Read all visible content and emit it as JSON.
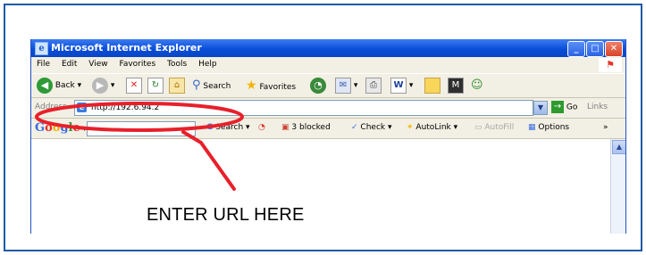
{
  "window": {
    "title": "Microsoft Internet Explorer"
  },
  "menu": [
    "File",
    "Edit",
    "View",
    "Favorites",
    "Tools",
    "Help"
  ],
  "toolbar": {
    "back_label": "Back",
    "search_label": "Search",
    "favorites_label": "Favorites"
  },
  "address": {
    "label": "Address",
    "url": "http://192.6.94.2",
    "go_label": "Go",
    "links_label": "Links"
  },
  "google_toolbar": {
    "logo": "Google",
    "search_label": "Search",
    "blocked_label": "3 blocked",
    "check_label": "Check",
    "autolink_label": "AutoLink",
    "autofill_label": "AutoFill",
    "options_label": "Options"
  },
  "annotation": {
    "callout_text": "ENTER URL HERE",
    "color": "#e8202a"
  }
}
